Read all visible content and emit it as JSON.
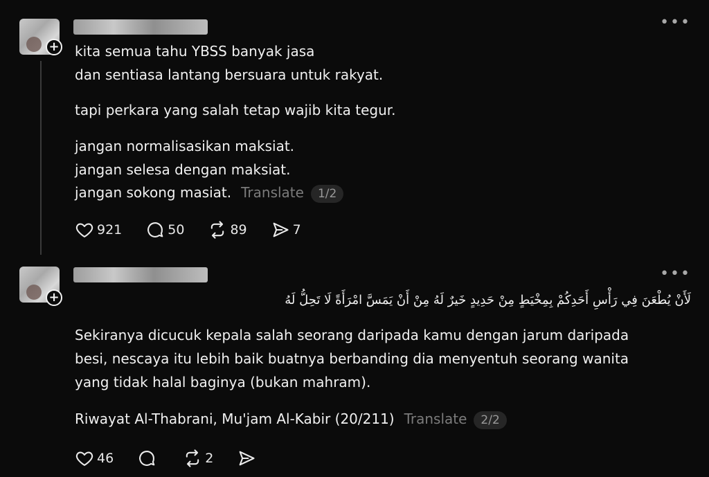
{
  "post1": {
    "lines": [
      "kita semua tahu YBSS banyak jasa",
      "dan sentiasa lantang bersuara untuk rakyat.",
      "tapi perkara yang salah tetap wajib kita tegur.",
      "jangan normalisasikan maksiat.",
      "jangan selesa dengan maksiat.",
      "jangan sokong masiat."
    ],
    "translate_label": "Translate",
    "pager": "1/2",
    "likes": "921",
    "replies": "50",
    "reposts": "89",
    "shares": "7"
  },
  "post2": {
    "arabic": "لَأَنْ يُطْعَنَ فِي رَأْسِ أَحَدِكُمْ بِمِخْيَطٍ مِنْ حَدِيدٍ خَيرٌ لَهُ مِنْ أَنْ يَمَسَّ امْرَأَةً لَا تَحِلُّ لَهُ",
    "lines": [
      "Sekiranya dicucuk kepala salah seorang daripada kamu dengan jarum daripada",
      "besi, nescaya itu lebih baik buatnya berbanding dia menyentuh seorang wanita",
      "yang tidak halal baginya (bukan mahram)."
    ],
    "source": "Riwayat Al-Thabrani, Mu'jam Al-Kabir (20/211)",
    "translate_label": "Translate",
    "pager": "2/2",
    "likes": "46",
    "replies": "",
    "reposts": "2",
    "shares": ""
  },
  "icons": {
    "more": "more-icon",
    "follow": "plus-icon",
    "like": "heart-icon",
    "reply": "comment-icon",
    "repost": "repost-icon",
    "share": "share-icon"
  }
}
